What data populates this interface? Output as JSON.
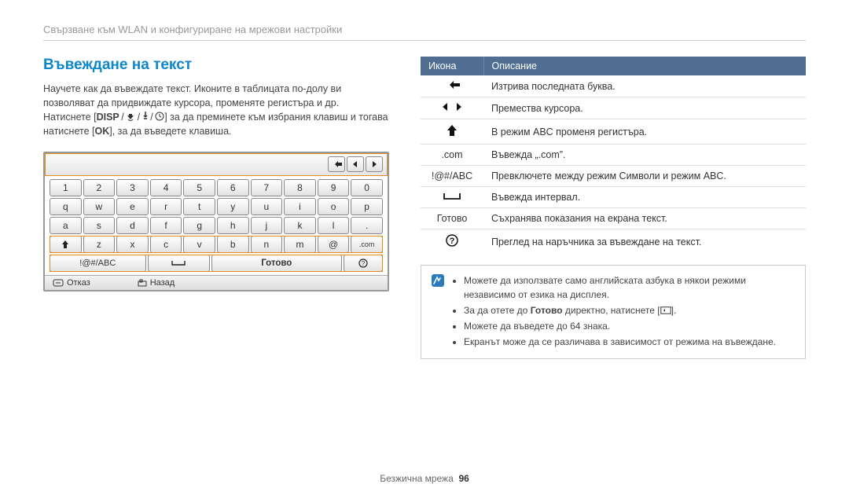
{
  "breadcrumb": "Свързване към WLAN и конфигуриране на мрежови настройки",
  "section_title": "Въвеждане на текст",
  "intro": {
    "part1": "Научете как да въвеждате текст. Иконите в таблицата по-долу ви позволяват да придвиждате курсора, променяте регистъра и др. Натиснете [",
    "disp": "DISP",
    "part2": "] за да преминете към избрания клавиш и тогава натиснете [",
    "part3": "], за да въведете клавиша."
  },
  "keyboard": {
    "rows": [
      [
        "1",
        "2",
        "3",
        "4",
        "5",
        "6",
        "7",
        "8",
        "9",
        "0"
      ],
      [
        "q",
        "w",
        "e",
        "r",
        "t",
        "y",
        "u",
        "i",
        "o",
        "p"
      ],
      [
        "a",
        "s",
        "d",
        "f",
        "g",
        "h",
        "j",
        "k",
        "l",
        "."
      ],
      [
        "",
        "z",
        "x",
        "c",
        "v",
        "b",
        "n",
        "m",
        "@",
        ".com"
      ]
    ],
    "imode_label": "!@#/ABC",
    "done_label": "Готово",
    "cancel_label": "Отказ",
    "back_label": "Назад"
  },
  "table": {
    "head_icon": "Икона",
    "head_desc": "Описание",
    "rows": [
      {
        "icon": "back-arrow",
        "desc": "Изтрива последната буква."
      },
      {
        "icon": "lr-arrows",
        "desc": "Премества курсора."
      },
      {
        "icon": "up-arrow",
        "desc": "В режим ABC променя регистъра."
      },
      {
        "icon": ".com",
        "desc": "Въвежда „.com”."
      },
      {
        "icon": "!@#/ABC",
        "desc": "Превключете между режим Символи и режим ABC."
      },
      {
        "icon": "space",
        "desc": "Въвежда интервал."
      },
      {
        "icon": "Готово",
        "desc": "Съхранява показания на екрана текст."
      },
      {
        "icon": "help",
        "desc": "Преглед на наръчника за въвеждане на текст."
      }
    ]
  },
  "note": {
    "l1": "Можете да използвате само английската азбука в някои режими независимо от езика на дисплея.",
    "l2a": "За да отете до ",
    "l2b": "Готово",
    "l2c": " директно, натиснете [",
    "l2d": "].",
    "l3": "Можете да въведете до 64 знака.",
    "l4": "Екранът може да се различава в зависимост от режима на въвеждане."
  },
  "footer": {
    "label": "Безжична мрежа",
    "page": "96"
  }
}
